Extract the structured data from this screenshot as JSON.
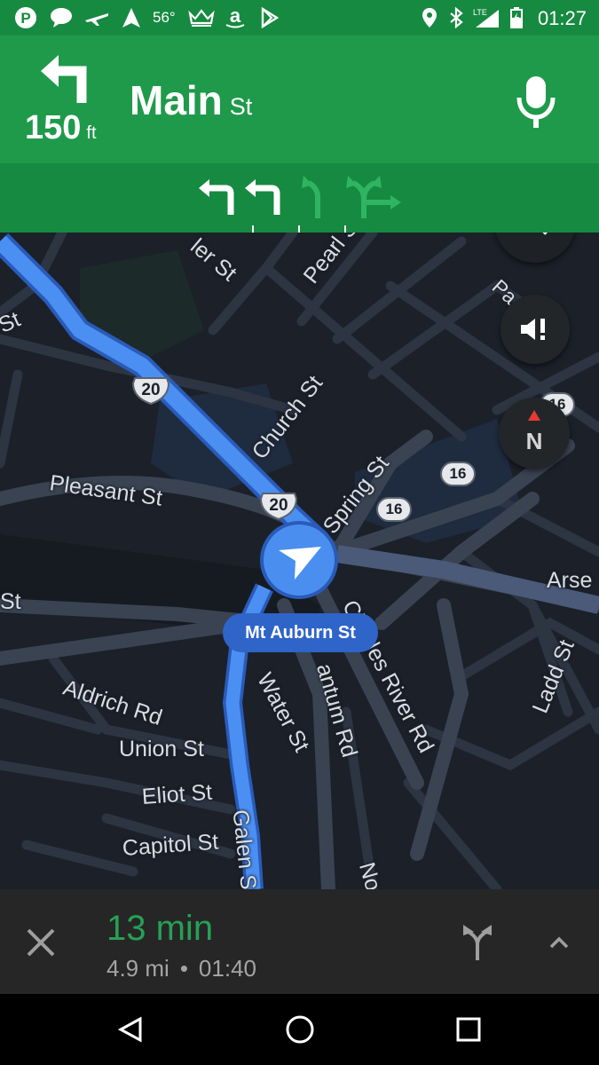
{
  "status_bar": {
    "temperature": "56°",
    "network": "LTE",
    "time": "01:27"
  },
  "navigation": {
    "distance_value": "150",
    "distance_unit": "ft",
    "street_name": "Main",
    "street_suffix": "St"
  },
  "map": {
    "labels": {
      "ler_st": "ler St",
      "pearl_st": "Pearl S",
      "st_left": "St",
      "pa_st": "Pa St",
      "church_st": "Church St",
      "spring_st": "Spring St",
      "pleasant_st": "Pleasant St",
      "arse": "Arse",
      "st_left2": "St",
      "aldrich_rd": "Aldrich Rd",
      "water_st": "Water St",
      "antum_rd": "antum Rd",
      "charles_river_rd": "Charles River Rd",
      "ladd_st": "Ladd St",
      "union_st": "Union St",
      "eliot_st": "Eliot St",
      "capitol_st": "Capitol St",
      "galen_st": "Galen St",
      "nor": "Nor"
    },
    "route_shields": {
      "us20_a": "20",
      "us20_b": "20",
      "rt16_a": "16",
      "rt16_b": "16",
      "rt16_c": "16"
    },
    "current_street": "Mt Auburn St",
    "compass_label": "N"
  },
  "trip": {
    "eta_minutes": "13 min",
    "distance": "4.9 mi",
    "separator": "•",
    "arrival_time": "01:40"
  },
  "colors": {
    "header_green": "#1f9a4b",
    "statusbar_green": "#168a40",
    "route_blue": "#4b8ff2",
    "eta_green": "#27a055",
    "map_bg": "#1b2029"
  }
}
